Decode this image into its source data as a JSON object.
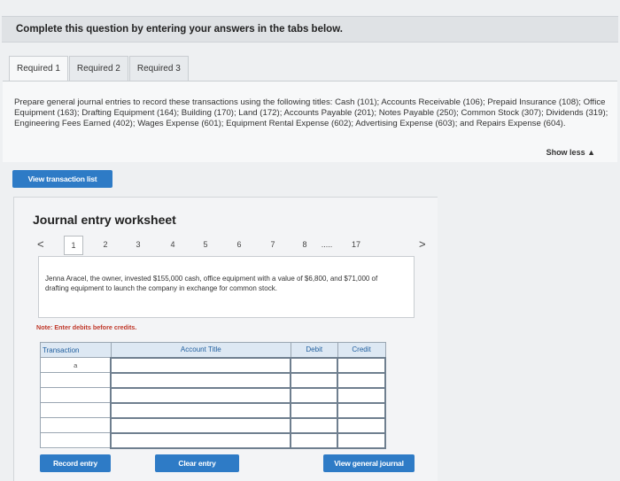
{
  "header": {
    "title": "Complete this question by entering your answers in the tabs below."
  },
  "tabs": [
    {
      "label": "Required 1"
    },
    {
      "label": "Required 2"
    },
    {
      "label": "Required 3"
    }
  ],
  "instructions": "Prepare general journal entries to record these transactions using the following titles: Cash (101); Accounts Receivable (106); Prepaid Insurance (108); Office Equipment (163); Drafting Equipment (164); Building (170); Land (172); Accounts Payable (201); Notes Payable (250); Common Stock (307); Dividends (319); Engineering Fees Earned (402); Wages Expense (601); Equipment Rental Expense (602); Advertising Expense (603); and Repairs Expense (604).",
  "show_less": "Show less ▲",
  "buttons": {
    "view_transaction_list": "View transaction list",
    "record_entry": "Record entry",
    "clear_entry": "Clear entry",
    "view_general_journal": "View general journal"
  },
  "worksheet": {
    "title": "Journal entry worksheet",
    "pager": {
      "prev": "<",
      "next": ">",
      "pages": [
        "1",
        "2",
        "3",
        "4",
        "5",
        "6",
        "7",
        "8",
        ".....",
        "17"
      ],
      "active_page": "1"
    },
    "description": "Jenna Aracel, the owner, invested $155,000 cash, office equipment with a value of $6,800, and $71,000 of drafting equipment to launch the company in exchange for common stock.",
    "note": "Note: Enter debits before credits.",
    "table": {
      "headers": {
        "transaction": "Transaction",
        "account": "Account Title",
        "debit": "Debit",
        "credit": "Credit"
      },
      "rows": [
        {
          "transaction": "a"
        },
        {
          "transaction": ""
        },
        {
          "transaction": ""
        },
        {
          "transaction": ""
        },
        {
          "transaction": ""
        },
        {
          "transaction": ""
        }
      ]
    }
  },
  "colors": {
    "button_blue": "#2e7bc6",
    "note_red": "#c0392b"
  }
}
